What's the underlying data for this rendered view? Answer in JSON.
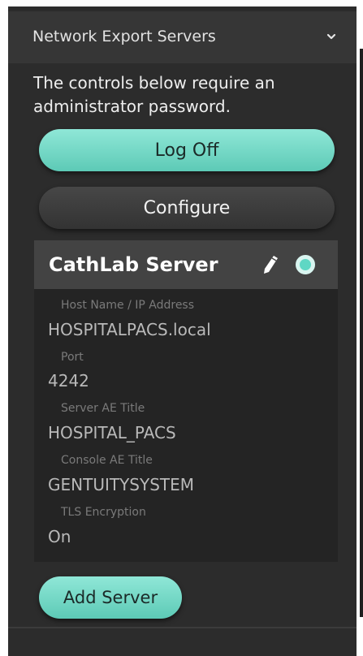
{
  "header": {
    "title": "Network Export Servers",
    "chevron_icon": "chevron-down-icon"
  },
  "notice": "The controls below require an administrator password.",
  "buttons": {
    "log_off": "Log Off",
    "configure": "Configure",
    "add_server": "Add Server"
  },
  "server": {
    "name": "CathLab Server",
    "edit_icon": "pencil-icon",
    "status_icon": "radio-selected-icon",
    "fields": [
      {
        "label": "Host Name / IP Address",
        "value": "HOSPITALPACS.local"
      },
      {
        "label": "Port",
        "value": "4242"
      },
      {
        "label": "Server AE Title",
        "value": "HOSPITAL_PACS"
      },
      {
        "label": "Console AE Title",
        "value": "GENTUITYSYSTEM"
      },
      {
        "label": "TLS Encryption",
        "value": "On"
      }
    ]
  },
  "colors": {
    "accent": "#6fd9c5",
    "panel": "#2c2c2c",
    "card": "#242424"
  }
}
